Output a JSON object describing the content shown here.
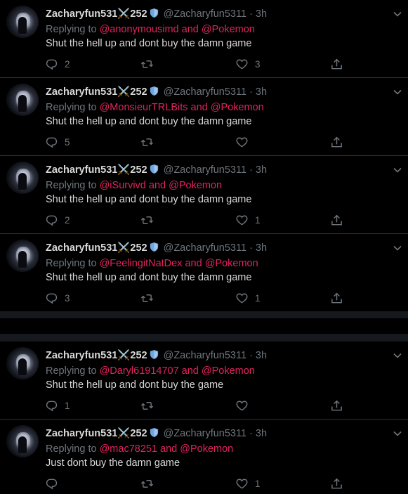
{
  "colors": {
    "background": "#000000",
    "text": "#d9d9d9",
    "muted": "#6e767d",
    "mention": "#e0245e",
    "divider": "#2f3336",
    "verified_badge": "#6ea7e0"
  },
  "tweets": [
    {
      "name": "Zacharyfun531⚔️252",
      "handle": "@Zacharyfun5311 · 3h",
      "replying_prefix": "Replying to ",
      "replying_to": "@anonymousimd and @Pokemon",
      "text": "Shut the hell up and dont buy the damn game",
      "reply_count": "2",
      "retweet_count": "",
      "like_count": "3"
    },
    {
      "name": "Zacharyfun531⚔️252",
      "handle": "@Zacharyfun5311 · 3h",
      "replying_prefix": "Replying to ",
      "replying_to": "@MonsieurTRLBits and @Pokemon",
      "text": "Shut the hell up and dont buy the damn game",
      "reply_count": "5",
      "retweet_count": "",
      "like_count": ""
    },
    {
      "name": "Zacharyfun531⚔️252",
      "handle": "@Zacharyfun5311 · 3h",
      "replying_prefix": "Replying to ",
      "replying_to": "@iSurvivd and @Pokemon",
      "text": "Shut the hell up and dont buy the damn game",
      "reply_count": "2",
      "retweet_count": "",
      "like_count": "1"
    },
    {
      "name": "Zacharyfun531⚔️252",
      "handle": "@Zacharyfun5311 · 3h",
      "replying_prefix": "Replying to ",
      "replying_to": "@FeelingitNatDex and @Pokemon",
      "text": "Shut the hell up and dont buy the damn game",
      "reply_count": "3",
      "retweet_count": "",
      "like_count": "1"
    },
    {
      "name": "Zacharyfun531⚔️252",
      "handle": "@Zacharyfun5311 · 3h",
      "replying_prefix": "Replying to ",
      "replying_to": "@Daryl61914707 and @Pokemon",
      "text": "Shut the hell up and dont buy the game",
      "reply_count": "1",
      "retweet_count": "",
      "like_count": ""
    },
    {
      "name": "Zacharyfun531⚔️252",
      "handle": "@Zacharyfun5311 · 3h",
      "replying_prefix": "Replying to ",
      "replying_to": "@mac78251 and @Pokemon",
      "text": "Just dont buy the damn game",
      "reply_count": "",
      "retweet_count": "",
      "like_count": "1"
    }
  ],
  "icons": {
    "reply": "reply-icon",
    "retweet": "retweet-icon",
    "like": "heart-icon",
    "share": "share-icon",
    "more": "chevron-down-icon",
    "verified": "shield-badge-icon"
  }
}
